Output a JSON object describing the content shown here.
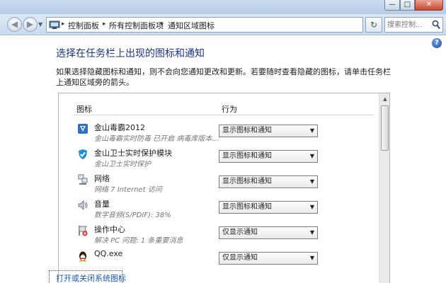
{
  "address_bar": {
    "breadcrumbs": [
      "控制面板",
      "所有控制面板项",
      "通知区域图标"
    ],
    "search_placeholder": "搜索控制..."
  },
  "window_buttons": {
    "minimize": "—",
    "maximize": "□",
    "close": "✕"
  },
  "page": {
    "title": "选择在任务栏上出现的图标和通知",
    "description": "如果选择隐藏图标和通知，则不会向您通知更改和更新。若要随时查看隐藏的图标，请单击任务栏上通知区域旁的箭头。"
  },
  "table": {
    "headers": {
      "icon": "图标",
      "action": "行为"
    },
    "rows": [
      {
        "name": "金山毒霸2012",
        "sub": "金山毒霸实时防毒 已开启 病毒库版本...",
        "action": "显示图标和通知",
        "icon": "shield-k-icon"
      },
      {
        "name": "金山卫士实时保护模块",
        "sub": "金山卫士实时保护",
        "action": "显示图标和通知",
        "icon": "shield-check-icon"
      },
      {
        "name": "网络",
        "sub": "网络 7 Internet 访问",
        "action": "显示图标和通知",
        "icon": "network-icon"
      },
      {
        "name": "音量",
        "sub": "数字音频(S/PDIF): 38%",
        "action": "显示图标和通知",
        "icon": "speaker-icon"
      },
      {
        "name": "操作中心",
        "sub": "解决 PC 问题: 1 条重要消息",
        "action": "仅显示通知",
        "icon": "action-center-flag-icon"
      },
      {
        "name": "QQ.exe",
        "sub": "",
        "action": "仅显示通知",
        "icon": "qq-penguin-icon"
      }
    ]
  },
  "footer": {
    "link": "打开或关闭系统图标"
  },
  "colors": {
    "title": "#1e3287",
    "link": "#1a55b4",
    "close_button": "#c8452c"
  }
}
